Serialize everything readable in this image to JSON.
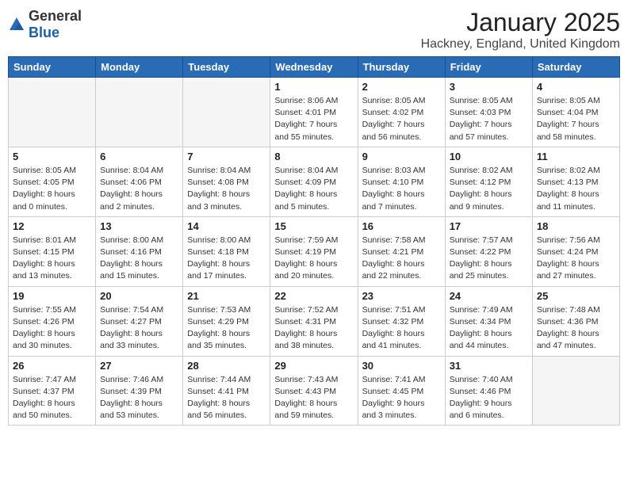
{
  "logo": {
    "general": "General",
    "blue": "Blue"
  },
  "header": {
    "month": "January 2025",
    "location": "Hackney, England, United Kingdom"
  },
  "weekdays": [
    "Sunday",
    "Monday",
    "Tuesday",
    "Wednesday",
    "Thursday",
    "Friday",
    "Saturday"
  ],
  "weeks": [
    [
      {
        "day": "",
        "detail": "",
        "empty": true
      },
      {
        "day": "",
        "detail": "",
        "empty": true
      },
      {
        "day": "",
        "detail": "",
        "empty": true
      },
      {
        "day": "1",
        "detail": "Sunrise: 8:06 AM\nSunset: 4:01 PM\nDaylight: 7 hours\nand 55 minutes.",
        "empty": false
      },
      {
        "day": "2",
        "detail": "Sunrise: 8:05 AM\nSunset: 4:02 PM\nDaylight: 7 hours\nand 56 minutes.",
        "empty": false
      },
      {
        "day": "3",
        "detail": "Sunrise: 8:05 AM\nSunset: 4:03 PM\nDaylight: 7 hours\nand 57 minutes.",
        "empty": false
      },
      {
        "day": "4",
        "detail": "Sunrise: 8:05 AM\nSunset: 4:04 PM\nDaylight: 7 hours\nand 58 minutes.",
        "empty": false
      }
    ],
    [
      {
        "day": "5",
        "detail": "Sunrise: 8:05 AM\nSunset: 4:05 PM\nDaylight: 8 hours\nand 0 minutes.",
        "empty": false
      },
      {
        "day": "6",
        "detail": "Sunrise: 8:04 AM\nSunset: 4:06 PM\nDaylight: 8 hours\nand 2 minutes.",
        "empty": false
      },
      {
        "day": "7",
        "detail": "Sunrise: 8:04 AM\nSunset: 4:08 PM\nDaylight: 8 hours\nand 3 minutes.",
        "empty": false
      },
      {
        "day": "8",
        "detail": "Sunrise: 8:04 AM\nSunset: 4:09 PM\nDaylight: 8 hours\nand 5 minutes.",
        "empty": false
      },
      {
        "day": "9",
        "detail": "Sunrise: 8:03 AM\nSunset: 4:10 PM\nDaylight: 8 hours\nand 7 minutes.",
        "empty": false
      },
      {
        "day": "10",
        "detail": "Sunrise: 8:02 AM\nSunset: 4:12 PM\nDaylight: 8 hours\nand 9 minutes.",
        "empty": false
      },
      {
        "day": "11",
        "detail": "Sunrise: 8:02 AM\nSunset: 4:13 PM\nDaylight: 8 hours\nand 11 minutes.",
        "empty": false
      }
    ],
    [
      {
        "day": "12",
        "detail": "Sunrise: 8:01 AM\nSunset: 4:15 PM\nDaylight: 8 hours\nand 13 minutes.",
        "empty": false
      },
      {
        "day": "13",
        "detail": "Sunrise: 8:00 AM\nSunset: 4:16 PM\nDaylight: 8 hours\nand 15 minutes.",
        "empty": false
      },
      {
        "day": "14",
        "detail": "Sunrise: 8:00 AM\nSunset: 4:18 PM\nDaylight: 8 hours\nand 17 minutes.",
        "empty": false
      },
      {
        "day": "15",
        "detail": "Sunrise: 7:59 AM\nSunset: 4:19 PM\nDaylight: 8 hours\nand 20 minutes.",
        "empty": false
      },
      {
        "day": "16",
        "detail": "Sunrise: 7:58 AM\nSunset: 4:21 PM\nDaylight: 8 hours\nand 22 minutes.",
        "empty": false
      },
      {
        "day": "17",
        "detail": "Sunrise: 7:57 AM\nSunset: 4:22 PM\nDaylight: 8 hours\nand 25 minutes.",
        "empty": false
      },
      {
        "day": "18",
        "detail": "Sunrise: 7:56 AM\nSunset: 4:24 PM\nDaylight: 8 hours\nand 27 minutes.",
        "empty": false
      }
    ],
    [
      {
        "day": "19",
        "detail": "Sunrise: 7:55 AM\nSunset: 4:26 PM\nDaylight: 8 hours\nand 30 minutes.",
        "empty": false
      },
      {
        "day": "20",
        "detail": "Sunrise: 7:54 AM\nSunset: 4:27 PM\nDaylight: 8 hours\nand 33 minutes.",
        "empty": false
      },
      {
        "day": "21",
        "detail": "Sunrise: 7:53 AM\nSunset: 4:29 PM\nDaylight: 8 hours\nand 35 minutes.",
        "empty": false
      },
      {
        "day": "22",
        "detail": "Sunrise: 7:52 AM\nSunset: 4:31 PM\nDaylight: 8 hours\nand 38 minutes.",
        "empty": false
      },
      {
        "day": "23",
        "detail": "Sunrise: 7:51 AM\nSunset: 4:32 PM\nDaylight: 8 hours\nand 41 minutes.",
        "empty": false
      },
      {
        "day": "24",
        "detail": "Sunrise: 7:49 AM\nSunset: 4:34 PM\nDaylight: 8 hours\nand 44 minutes.",
        "empty": false
      },
      {
        "day": "25",
        "detail": "Sunrise: 7:48 AM\nSunset: 4:36 PM\nDaylight: 8 hours\nand 47 minutes.",
        "empty": false
      }
    ],
    [
      {
        "day": "26",
        "detail": "Sunrise: 7:47 AM\nSunset: 4:37 PM\nDaylight: 8 hours\nand 50 minutes.",
        "empty": false
      },
      {
        "day": "27",
        "detail": "Sunrise: 7:46 AM\nSunset: 4:39 PM\nDaylight: 8 hours\nand 53 minutes.",
        "empty": false
      },
      {
        "day": "28",
        "detail": "Sunrise: 7:44 AM\nSunset: 4:41 PM\nDaylight: 8 hours\nand 56 minutes.",
        "empty": false
      },
      {
        "day": "29",
        "detail": "Sunrise: 7:43 AM\nSunset: 4:43 PM\nDaylight: 8 hours\nand 59 minutes.",
        "empty": false
      },
      {
        "day": "30",
        "detail": "Sunrise: 7:41 AM\nSunset: 4:45 PM\nDaylight: 9 hours\nand 3 minutes.",
        "empty": false
      },
      {
        "day": "31",
        "detail": "Sunrise: 7:40 AM\nSunset: 4:46 PM\nDaylight: 9 hours\nand 6 minutes.",
        "empty": false
      },
      {
        "day": "",
        "detail": "",
        "empty": true
      }
    ]
  ]
}
